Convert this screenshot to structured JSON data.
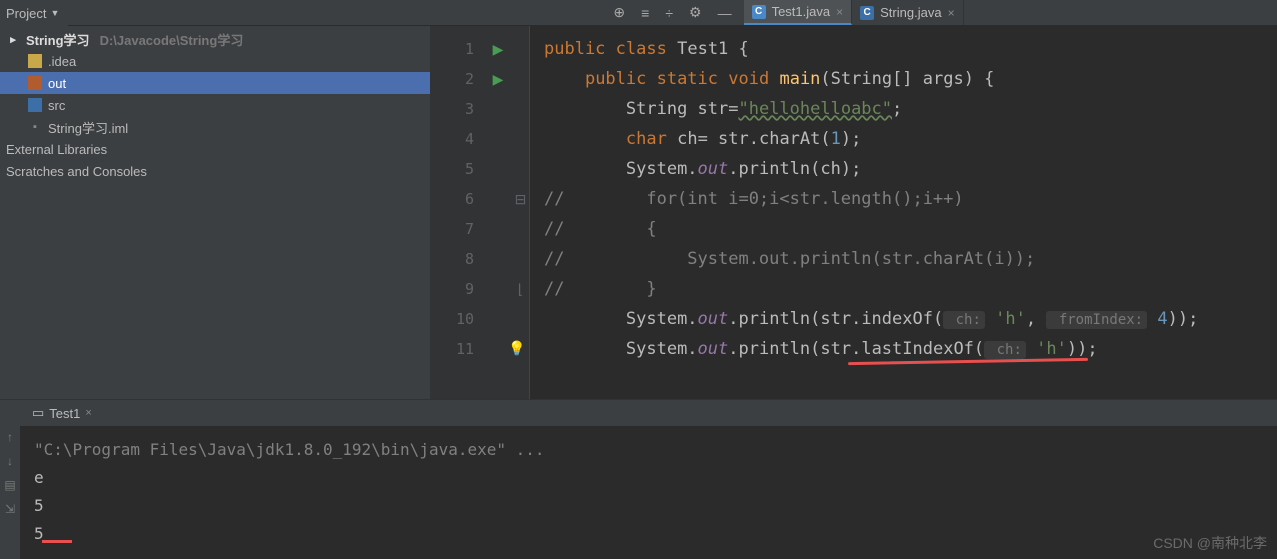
{
  "header": {
    "project_label": "Project"
  },
  "tabs": [
    {
      "label": "Test1.java",
      "active": true
    },
    {
      "label": "String.java",
      "active": false
    }
  ],
  "tree": {
    "root": {
      "name": "String学习",
      "path": "D:\\Javacode\\String学习"
    },
    "items": [
      {
        "icon": "folder-yellow",
        "name": ".idea"
      },
      {
        "icon": "folder-orange",
        "name": "out"
      },
      {
        "icon": "folder-blue",
        "name": "src"
      },
      {
        "icon": "file",
        "name": "String学习.iml"
      }
    ],
    "ext1": "External Libraries",
    "ext2": "Scratches and Consoles"
  },
  "code": {
    "lines": [
      1,
      2,
      3,
      4,
      5,
      6,
      7,
      8,
      9,
      10,
      11
    ],
    "l1a": "public",
    "l1b": "class",
    "l1c": "Test1 {",
    "l2a": "public static",
    "l2b": "void",
    "l2c": "main",
    "l2d": "(String[] args) {",
    "l3a": "String str=",
    "l3b": "\"hellohelloabc\"",
    "l3c": ";",
    "l4a": "char",
    "l4b": "ch= str.charAt(",
    "l4c": "1",
    "l4d": ");",
    "l5a": "System.",
    "l5b": "out",
    "l5c": ".println(ch);",
    "l6": "//        for(int i=0;i<str.length();i++)",
    "l7": "//        {",
    "l8": "//            System.out.println(str.charAt(i));",
    "l9": "//        }",
    "l10a": "System.",
    "l10b": "out",
    "l10c": ".println(str.indexOf(",
    "l10h1": " ch:",
    "l10v1": "'h'",
    "l10cm": ",",
    "l10h2": " fromIndex:",
    "l10v2": "4",
    "l10d": "));",
    "l11a": "System.",
    "l11b": "out",
    "l11c": ".println(str.",
    "l11m": "lastIndexOf",
    "l11d": "(",
    "l11h": " ch:",
    "l11v": "'h'",
    "l11e": "));"
  },
  "run": {
    "tab": "Test1",
    "cmd": "\"C:\\Program Files\\Java\\jdk1.8.0_192\\bin\\java.exe\" ...",
    "o1": "e",
    "o2": "5",
    "o3": "5"
  },
  "watermark": "CSDN @南种北李"
}
